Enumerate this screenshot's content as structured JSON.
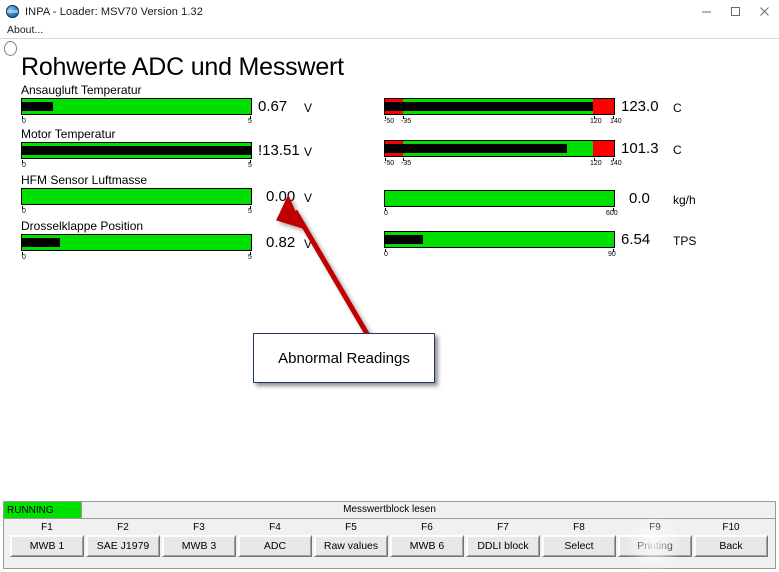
{
  "window": {
    "title": "INPA - Loader: MSV70 Version 1.32",
    "icon": "inpa-globe-icon",
    "minimize_label": "–",
    "maximize_label": "□",
    "close_label": "✕"
  },
  "menu": {
    "items": [
      {
        "label": "About..."
      }
    ]
  },
  "page": {
    "title": "Rohwerte ADC und Messwert"
  },
  "gauges_left": [
    {
      "label": "Ansaugluft Temperatur",
      "value": "0.67",
      "unit": "V",
      "min_tick": "0",
      "max_tick": "5",
      "fill_percent": 13.4,
      "abnormal": false
    },
    {
      "label": "Motor Temperatur",
      "value": "!13.51",
      "unit": "V",
      "min_tick": "0",
      "max_tick": "5",
      "fill_percent": 100,
      "abnormal": true
    },
    {
      "label": "HFM Sensor Luftmasse",
      "value": "0.00",
      "unit": "V",
      "min_tick": "0",
      "max_tick": "5",
      "fill_percent": 0,
      "abnormal": false
    },
    {
      "label": "Drosselklappe Position",
      "value": "0.82",
      "unit": "V",
      "min_tick": "0",
      "max_tick": "5",
      "fill_percent": 16.4,
      "abnormal": false
    }
  ],
  "gauges_right": [
    {
      "value": "123.0",
      "unit": "C",
      "ticks": [
        "-50",
        "-35",
        "120",
        "140"
      ],
      "fill_percent": 91,
      "zone_low_percent": 8,
      "zone_high_start_percent": 91,
      "abnormal": true
    },
    {
      "value": "101.3",
      "unit": "C",
      "ticks": [
        "-50",
        "-35",
        "120",
        "140"
      ],
      "fill_percent": 79.5,
      "zone_low_percent": 8,
      "zone_high_start_percent": 91,
      "abnormal": true
    },
    {
      "value": "0.0",
      "unit": "kg/h",
      "ticks": [
        "0",
        "600"
      ],
      "fill_percent": 0,
      "zone_low_percent": 0,
      "zone_high_start_percent": 100,
      "abnormal": false
    },
    {
      "value": "6.54",
      "unit": "TPS",
      "ticks": [
        "0",
        "90"
      ],
      "fill_percent": 16.5,
      "zone_low_percent": 0,
      "zone_high_start_percent": 100,
      "abnormal": false
    }
  ],
  "annotation": {
    "text": "Abnormal Readings",
    "arrow_color": "#c00000",
    "border_color": "#1f3864"
  },
  "status": {
    "badge": "RUNNING",
    "badge_color": "#00e000",
    "message": "Messwertblock lesen"
  },
  "function_keys": [
    {
      "key": "F1",
      "label": "MWB 1"
    },
    {
      "key": "F2",
      "label": "SAE J1979"
    },
    {
      "key": "F3",
      "label": "MWB 3"
    },
    {
      "key": "F4",
      "label": "ADC"
    },
    {
      "key": "F5",
      "label": "Raw values"
    },
    {
      "key": "F6",
      "label": "MWB 6"
    },
    {
      "key": "F7",
      "label": "DDLI block"
    },
    {
      "key": "F8",
      "label": "Select"
    },
    {
      "key": "F9",
      "label": "Printing"
    },
    {
      "key": "F10",
      "label": "Back"
    }
  ],
  "colors": {
    "gauge_green": "#00e000",
    "gauge_red": "#ff0000",
    "gauge_fill": "#000000"
  }
}
